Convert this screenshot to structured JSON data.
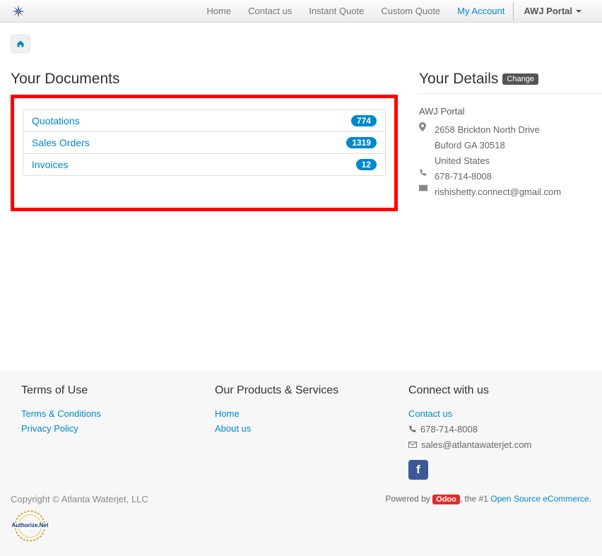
{
  "nav": {
    "items": [
      "Home",
      "Contact us",
      "Instant Quote",
      "Custom Quote",
      "My Account"
    ],
    "active_index": 4,
    "user": "AWJ Portal"
  },
  "documents": {
    "heading": "Your Documents",
    "items": [
      {
        "label": "Quotations",
        "count": "774"
      },
      {
        "label": "Sales Orders",
        "count": "1319"
      },
      {
        "label": "Invoices",
        "count": "12"
      }
    ]
  },
  "details": {
    "heading": "Your Details",
    "change_label": "Change",
    "name": "AWJ Portal",
    "address_line1": "2658 Brickton North Drive",
    "address_line2": "Buford GA 30518",
    "address_line3": "United States",
    "phone": "678-714-8008",
    "email": "rishishetty.connect@gmail.com"
  },
  "footer": {
    "col1": {
      "heading": "Terms of Use",
      "links": [
        "Terms & Conditions",
        "Privacy Policy"
      ]
    },
    "col2": {
      "heading": "Our Products & Services",
      "links": [
        "Home",
        "About us"
      ]
    },
    "col3": {
      "heading": "Connect with us",
      "contact_link": "Contact us",
      "phone": "678-714-8008",
      "email": "sales@atlantawaterjet.com"
    },
    "copyright": "Copyright © Atlanta Waterjet, LLC",
    "powered_prefix": "Powered by",
    "odoo": "Odoo",
    "powered_mid": ", the #1 ",
    "powered_link": "Open Source eCommerce",
    "authorize": "Authorize.Net"
  }
}
